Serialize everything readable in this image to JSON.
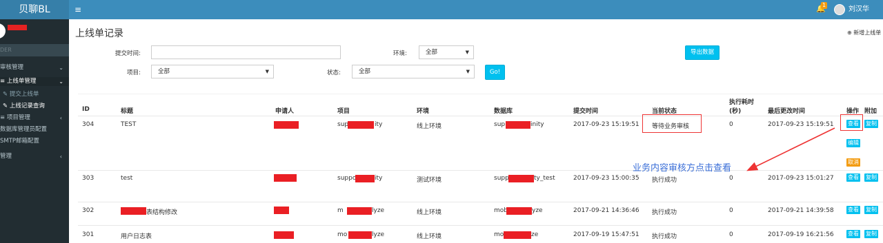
{
  "app": {
    "brand": "贝聊BL",
    "menu_icon": "≡"
  },
  "header": {
    "notification_count": "1",
    "user_name": "刘汉华"
  },
  "sidebar": {
    "search_placeholder": "DER",
    "items": [
      {
        "label": "审核管理",
        "chevron": "⌄"
      },
      {
        "label": "≡ 上线单管理",
        "chevron": "⌄"
      },
      {
        "label": "✎ 提交上线单"
      },
      {
        "label": "✎ 上线记录查询"
      },
      {
        "label": "≡ 项目管理",
        "chevron": "‹"
      },
      {
        "label": "数据库管理员配置"
      },
      {
        "label": "SMTP邮箱配置"
      },
      {
        "label": "管理",
        "chevron": "‹"
      }
    ]
  },
  "page": {
    "title": "上线单记录",
    "add_link": "新增上线单"
  },
  "filters": {
    "submit_time_label": "提交时间:",
    "env_label": "环境:",
    "env_value": "全部",
    "export_button": "导出数据",
    "project_label": "项目:",
    "project_value": "全部",
    "status_label": "状态:",
    "status_value": "全部",
    "go_button": "Go!"
  },
  "table": {
    "headers": [
      "ID",
      "标题",
      "申请人",
      "项目",
      "环境",
      "数据库",
      "提交时间",
      "当前状态",
      "执行耗时",
      "(秒)",
      "最后更改时间",
      "操作",
      "附加"
    ],
    "rows": [
      {
        "id": "304",
        "title": "TEST",
        "project_prefix": "sup",
        "project_suffix": "ity",
        "env": "线上环境",
        "db_prefix": "sup",
        "db_suffix": "inity",
        "submit_time": "2017-09-23 15:19:51",
        "status": "等待业务审核",
        "duration": "0",
        "updated": "2017-09-23 15:19:51"
      },
      {
        "id": "303",
        "title": "test",
        "project_prefix": "suppo",
        "project_suffix": "ity",
        "env": "测试环境",
        "db_prefix": "supp",
        "db_suffix": "ty_test",
        "submit_time": "2017-09-23 15:00:35",
        "status": "执行成功",
        "duration": "0",
        "updated": "2017-09-23 15:01:27"
      },
      {
        "id": "302",
        "title": "表结构修改",
        "project_prefix": "m",
        "project_suffix": "lyze",
        "env": "线上环境",
        "db_prefix": "mob",
        "db_suffix": "yze",
        "submit_time": "2017-09-21 14:36:46",
        "status": "执行成功",
        "duration": "0",
        "updated": "2017-09-21 14:39:58"
      },
      {
        "id": "301",
        "title": "用户日志表",
        "project_prefix": "mo",
        "project_suffix": "lyze",
        "env": "线上环境",
        "db_prefix": "mo",
        "db_suffix": "ze",
        "submit_time": "2017-09-19 15:47:51",
        "status": "执行成功",
        "duration": "0",
        "updated": "2017-09-19 16:21:56"
      }
    ],
    "actions": {
      "view": "查看",
      "copy": "复制",
      "edit": "编辑",
      "cancel": "取消"
    }
  },
  "annotation": "业务内容审核方点击查看",
  "colors": {
    "topbar": "#3c8dbc",
    "sidebar": "#222d32",
    "accent": "#00c0ef",
    "redaction": "#ea1f24",
    "annotation": "#3b6fd8"
  }
}
